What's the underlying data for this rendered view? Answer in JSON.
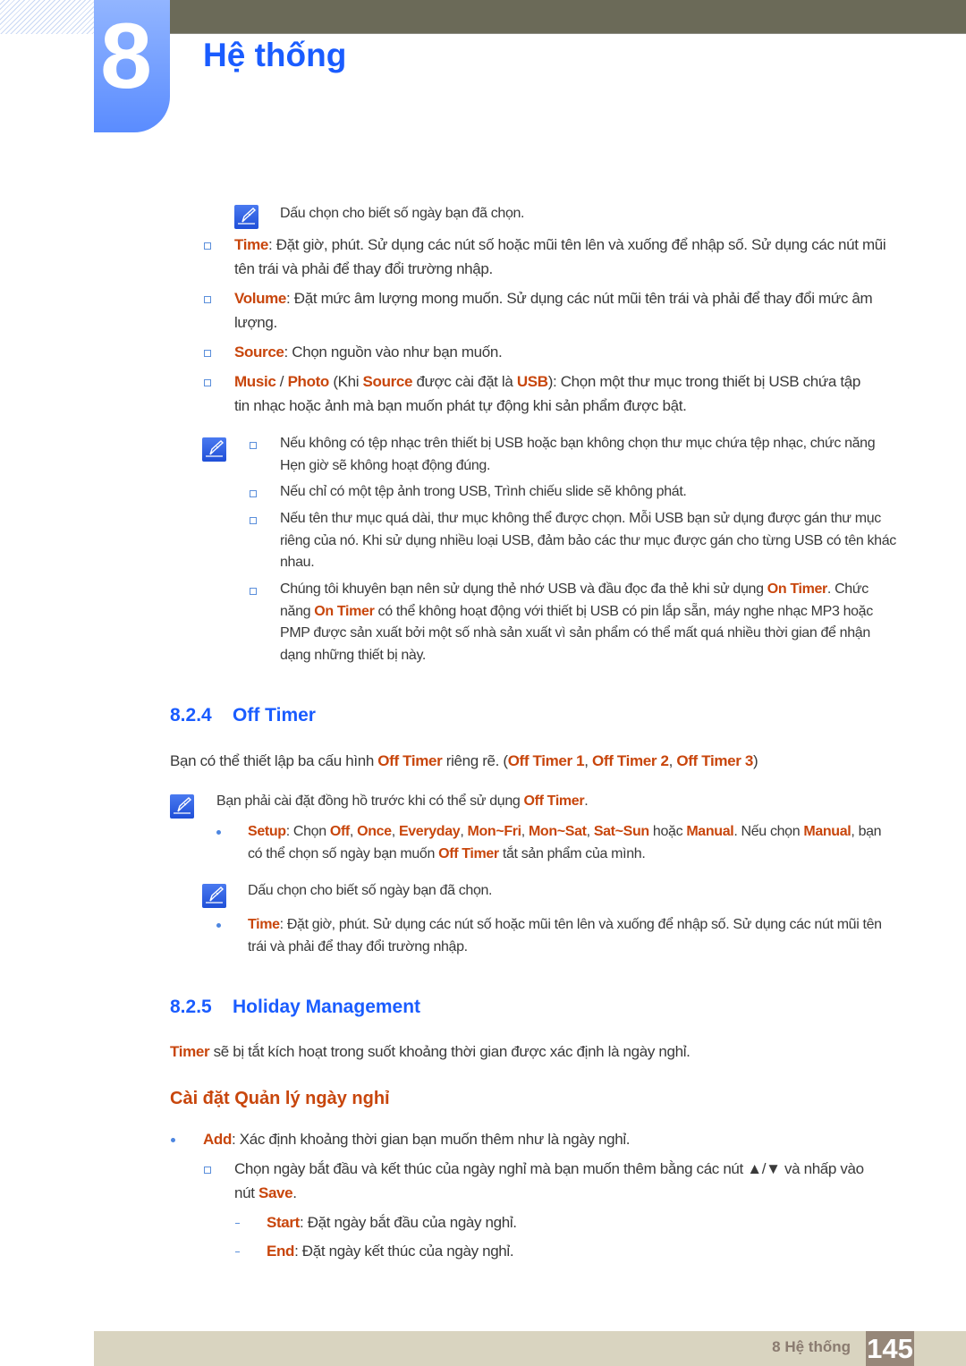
{
  "header": {
    "chapter_number": "8",
    "chapter_title": "Hệ thống"
  },
  "colors": {
    "accent_blue": "#1a5cff",
    "highlight_orange": "#c8460c",
    "header_bar": "#6b6a58",
    "footer": "#d9d4c0"
  },
  "blocks": [
    {
      "id": "note1",
      "segments": [
        {
          "t": "Dấu chọn cho biết số ngày bạn đã chọn."
        }
      ]
    },
    {
      "id": "time1",
      "segments": [
        {
          "t": "Time",
          "b": 1
        },
        {
          "t": ": Đặt giờ, phút. Sử dụng các nút số hoặc mũi tên lên và xuống để nhập số. Sử dụng các nút mũi tên trái và phải để thay đổi trường nhập."
        }
      ]
    },
    {
      "id": "volume",
      "segments": [
        {
          "t": "Volume",
          "b": 1
        },
        {
          "t": ": Đặt mức âm lượng mong muốn. Sử dụng các nút mũi tên trái và phải để thay đổi mức âm lượng."
        }
      ]
    },
    {
      "id": "source",
      "segments": [
        {
          "t": "Source",
          "b": 1
        },
        {
          "t": ": Chọn nguồn vào như bạn muốn."
        }
      ]
    },
    {
      "id": "music",
      "segments": [
        {
          "t": "Music",
          "b": 1
        },
        {
          "t": " / "
        },
        {
          "t": "Photo",
          "b": 1
        },
        {
          "t": " (Khi "
        },
        {
          "t": "Source",
          "b": 1
        },
        {
          "t": " được cài đặt là "
        },
        {
          "t": "USB",
          "b": 1
        },
        {
          "t": "): Chọn một thư mục trong thiết bị USB chứa tập tin nhạc hoặc ảnh mà bạn muốn phát tự động khi sản phẩm được bật."
        }
      ]
    },
    {
      "id": "sub1",
      "segments": [
        {
          "t": "Nếu không có tệp nhạc trên thiết bị USB hoặc bạn không chọn thư mục chứa tệp nhạc, chức năng Hẹn giờ sẽ không hoạt động đúng."
        }
      ]
    },
    {
      "id": "sub2",
      "segments": [
        {
          "t": "Nếu chỉ có một tệp ảnh trong USB, Trình chiếu slide sẽ không phát."
        }
      ]
    },
    {
      "id": "sub3",
      "segments": [
        {
          "t": "Nếu tên thư mục quá dài, thư mục không thể được chọn. Mỗi USB bạn sử dụng được gán thư mục riêng của nó. Khi sử dụng nhiều loại USB, đảm bảo các thư mục được gán cho từng USB có tên khác nhau."
        }
      ]
    },
    {
      "id": "sub4",
      "segments": [
        {
          "t": "Chúng tôi khuyên bạn nên sử dụng thẻ nhớ USB và đầu đọc đa thẻ khi sử dụng "
        },
        {
          "t": "On Timer",
          "b": 1
        },
        {
          "t": ". Chức năng "
        },
        {
          "t": "On Timer",
          "b": 1
        },
        {
          "t": " có thể không hoạt động với thiết bị USB có pin lắp sẵn, máy nghe nhạc MP3 hoặc PMP được sản xuất bởi một số nhà sản xuất vì sản phẩm có thể mất quá nhiều thời gian để nhận dạng những thiết bị này."
        }
      ]
    },
    {
      "id": "offintro",
      "segments": [
        {
          "t": "Bạn có thể thiết lập ba cấu hình "
        },
        {
          "t": "Off Timer",
          "b": 1
        },
        {
          "t": " riêng rẽ. ("
        },
        {
          "t": "Off Timer 1",
          "b": 1
        },
        {
          "t": ", "
        },
        {
          "t": "Off Timer 2",
          "b": 1
        },
        {
          "t": ", "
        },
        {
          "t": "Off Timer 3",
          "b": 1
        },
        {
          "t": ")"
        }
      ]
    },
    {
      "id": "note2",
      "segments": [
        {
          "t": "Bạn phải cài đặt đồng hồ trước khi có thể sử dụng "
        },
        {
          "t": "Off Timer",
          "b": 1
        },
        {
          "t": "."
        }
      ]
    },
    {
      "id": "setup",
      "segments": [
        {
          "t": "Setup",
          "b": 1
        },
        {
          "t": ": Chọn "
        },
        {
          "t": "Off",
          "b": 1
        },
        {
          "t": ", "
        },
        {
          "t": "Once",
          "b": 1
        },
        {
          "t": ", "
        },
        {
          "t": "Everyday",
          "b": 1
        },
        {
          "t": ", "
        },
        {
          "t": "Mon~Fri",
          "b": 1
        },
        {
          "t": ", "
        },
        {
          "t": "Mon~Sat",
          "b": 1
        },
        {
          "t": ", "
        },
        {
          "t": "Sat~Sun",
          "b": 1
        },
        {
          "t": " hoặc "
        },
        {
          "t": "Manual",
          "b": 1
        },
        {
          "t": ". Nếu chọn "
        },
        {
          "t": "Manual",
          "b": 1
        },
        {
          "t": ", bạn có thể chọn số ngày bạn muốn "
        },
        {
          "t": "Off Timer",
          "b": 1
        },
        {
          "t": " tắt sản phẩm của mình."
        }
      ]
    },
    {
      "id": "note3",
      "segments": [
        {
          "t": "Dấu chọn cho biết số ngày bạn đã chọn."
        }
      ]
    },
    {
      "id": "time2",
      "segments": [
        {
          "t": "Time",
          "b": 1
        },
        {
          "t": ": Đặt giờ, phút. Sử dụng các nút số hoặc mũi tên lên và xuống để nhập số. Sử dụng các nút mũi tên trái và phải để thay đổi trường nhập."
        }
      ]
    },
    {
      "id": "holintro",
      "segments": [
        {
          "t": "Timer",
          "b": 1
        },
        {
          "t": " sẽ bị tắt kích hoạt trong suốt khoảng thời gian được xác định là ngày nghỉ."
        }
      ]
    },
    {
      "id": "add",
      "segments": [
        {
          "t": "Add",
          "b": 1
        },
        {
          "t": ": Xác định khoảng thời gian bạn muốn thêm như là ngày nghỉ."
        }
      ]
    },
    {
      "id": "choose",
      "segments": [
        {
          "t": "Chọn ngày bắt đầu và kết thúc của ngày nghỉ mà bạn muốn thêm bằng các nút ▲/▼ và nhấp vào nút "
        },
        {
          "t": "Save",
          "b": 1
        },
        {
          "t": "."
        }
      ]
    },
    {
      "id": "start",
      "segments": [
        {
          "t": "Start",
          "b": 1
        },
        {
          "t": ": Đặt ngày bắt đầu của ngày nghỉ."
        }
      ]
    },
    {
      "id": "end",
      "segments": [
        {
          "t": "End",
          "b": 1
        },
        {
          "t": ": Đặt ngày kết thúc của ngày nghỉ."
        }
      ]
    }
  ],
  "sections": {
    "s824": {
      "number": "8.2.4",
      "title": "Off Timer"
    },
    "s825": {
      "number": "8.2.5",
      "title": "Holiday Management"
    },
    "subheading": "Cài đặt Quản lý ngày nghỉ"
  },
  "footer": {
    "label": "8 Hệ thống",
    "page": "145"
  }
}
